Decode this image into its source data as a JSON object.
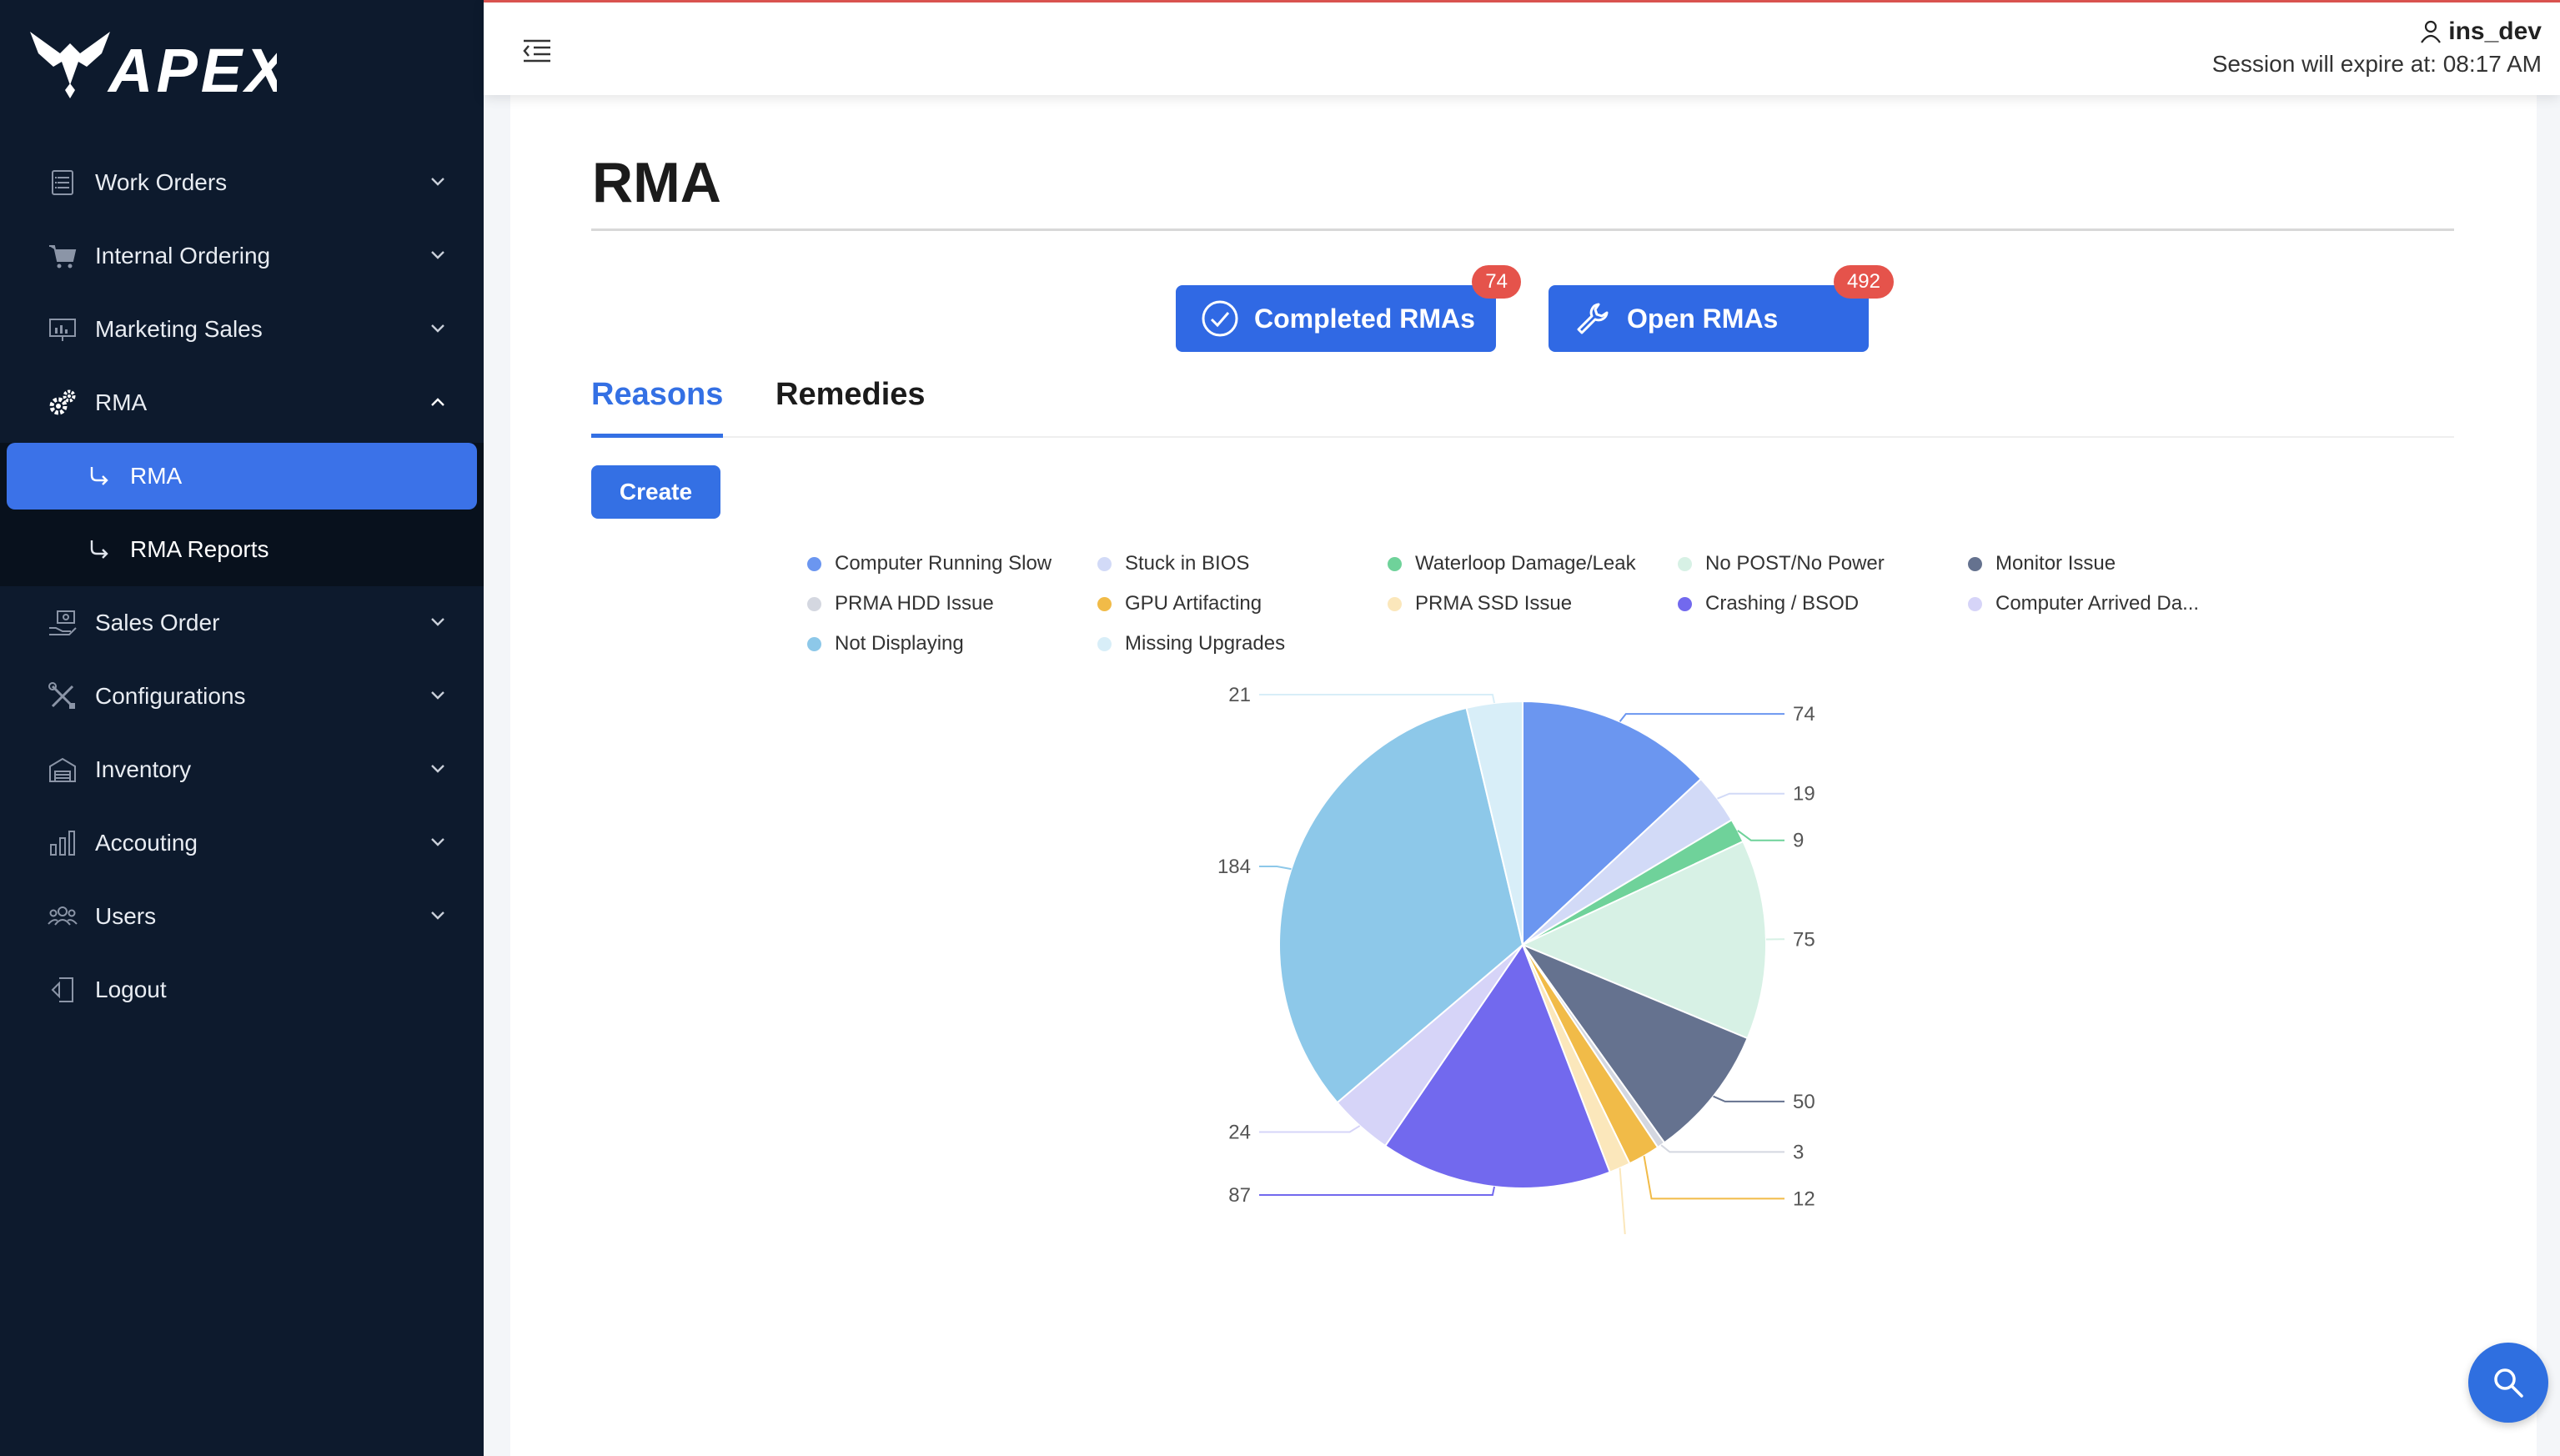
{
  "brand": {
    "name": "APEX"
  },
  "sidebar": {
    "items": [
      {
        "label": "Work Orders",
        "icon": "clipboard-list-icon"
      },
      {
        "label": "Internal Ordering",
        "icon": "cart-icon"
      },
      {
        "label": "Marketing Sales",
        "icon": "presentation-icon"
      },
      {
        "label": "RMA",
        "icon": "gears-icon",
        "expanded": true,
        "children": [
          {
            "label": "RMA",
            "active": true
          },
          {
            "label": "RMA Reports",
            "active": false
          }
        ]
      },
      {
        "label": "Sales Order",
        "icon": "hand-money-icon"
      },
      {
        "label": "Configurations",
        "icon": "tools-icon"
      },
      {
        "label": "Inventory",
        "icon": "warehouse-icon"
      },
      {
        "label": "Accouting",
        "icon": "bar-chart-icon"
      },
      {
        "label": "Users",
        "icon": "users-icon"
      },
      {
        "label": "Logout",
        "icon": "logout-icon"
      }
    ]
  },
  "header": {
    "username": "ins_dev",
    "session_text": "Session will expire at: 08:17 AM"
  },
  "page": {
    "title": "RMA",
    "completed_button": {
      "label": "Completed RMAs",
      "count": "74"
    },
    "open_button": {
      "label": "Open RMAs",
      "count": "492"
    },
    "tabs": [
      {
        "label": "Reasons",
        "active": true
      },
      {
        "label": "Remedies",
        "active": false
      }
    ],
    "create_label": "Create"
  },
  "chart_data": {
    "type": "pie",
    "title": "",
    "legend_position": "top",
    "slices": [
      {
        "name": "Computer Running Slow",
        "value": 74,
        "color": "#6b96f0"
      },
      {
        "name": "Stuck in BIOS",
        "value": 19,
        "color": "#d2daf7"
      },
      {
        "name": "Waterloop Damage/Leak",
        "value": 9,
        "color": "#6fd29a"
      },
      {
        "name": "No POST/No Power",
        "value": 75,
        "color": "#d7f1e5"
      },
      {
        "name": "Monitor Issue",
        "value": 50,
        "color": "#65728f"
      },
      {
        "name": "PRMA HDD Issue",
        "value": 3,
        "color": "#d4d7e0"
      },
      {
        "name": "GPU Artifacting",
        "value": 12,
        "color": "#f1bb48"
      },
      {
        "name": "PRMA SSD Issue",
        "value": 8,
        "color": "#fbe7bb"
      },
      {
        "name": "Crashing / BSOD",
        "value": 87,
        "color": "#7269ee"
      },
      {
        "name": "Computer Arrived Da...",
        "value": 24,
        "color": "#d6d4f8"
      },
      {
        "name": "Not Displaying",
        "value": 184,
        "color": "#8dc8e9"
      },
      {
        "name": "Missing Upgrades",
        "value": 21,
        "color": "#d8eef8"
      }
    ]
  },
  "search_fab": {
    "icon": "search-icon"
  }
}
